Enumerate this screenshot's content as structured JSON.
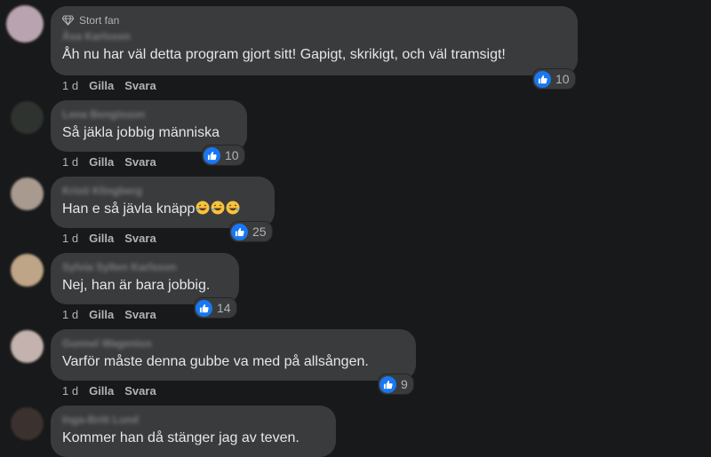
{
  "comments": [
    {
      "badge": "Stort fan",
      "author": "Åsa Karlsson",
      "text": "Åh nu har väl detta program gjort sitt! Gapigt, skrikigt, och väl tramsigt!",
      "time": "1 d",
      "like_label": "Gilla",
      "reply_label": "Svara",
      "reactions": "10",
      "avatar_color": "#b9a3b0"
    },
    {
      "author": "Lena Bengtsson",
      "text": "Så jäkla jobbig människa",
      "time": "1 d",
      "like_label": "Gilla",
      "reply_label": "Svara",
      "reactions": "10",
      "avatar_color": "#2f3330"
    },
    {
      "author": "Kristi Klingberg",
      "text": "Han e så jävla knäpp",
      "emojis": [
        "rolling-on-floor-laughing",
        "rolling-on-floor-laughing",
        "rolling-on-floor-laughing"
      ],
      "time": "1 d",
      "like_label": "Gilla",
      "reply_label": "Svara",
      "reactions": "25",
      "avatar_color": "#a99a90"
    },
    {
      "author": "Sylvia Sylten Karlsson",
      "text": "Nej, han är bara jobbig.",
      "time": "1 d",
      "like_label": "Gilla",
      "reply_label": "Svara",
      "reactions": "14",
      "avatar_color": "#bfa587"
    },
    {
      "author": "Gunnel Wagenius",
      "text": "Varför måste denna gubbe va med på allsången.",
      "time": "1 d",
      "like_label": "Gilla",
      "reply_label": "Svara",
      "reactions": "9",
      "avatar_color": "#c3b2ad"
    },
    {
      "author": "Inga-Britt Lund",
      "text": "Kommer han då stänger jag av teven.",
      "avatar_color": "#3b3230"
    }
  ],
  "colors": {
    "background": "#18191a",
    "bubble": "#3a3b3c",
    "like_blue": "#1877f2",
    "secondary_text": "#b0b3b8"
  }
}
